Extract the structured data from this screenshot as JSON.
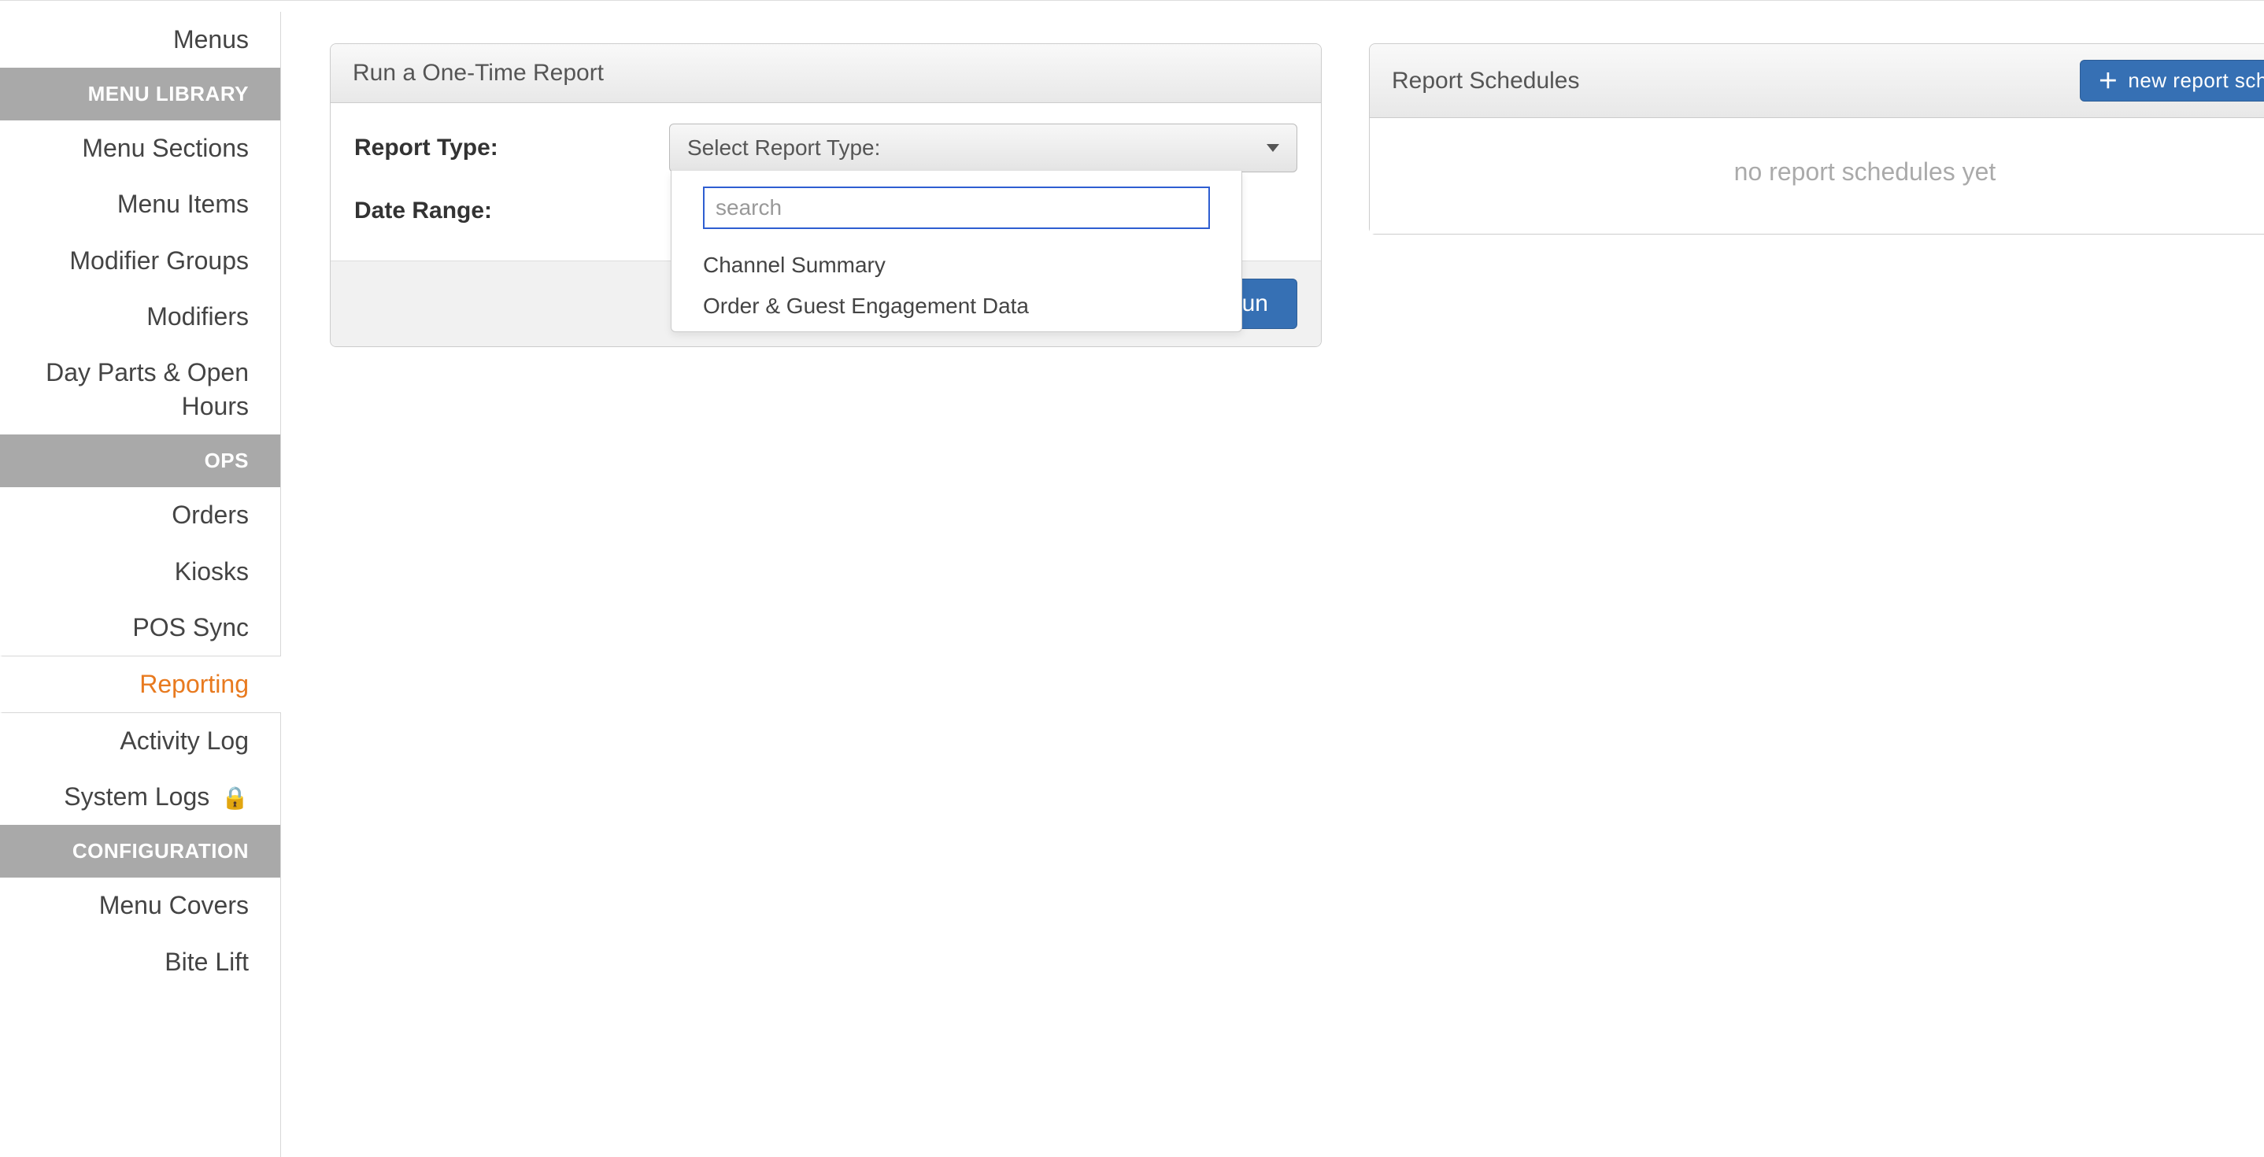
{
  "sidebar": {
    "top_items": [
      {
        "label": "Menus"
      }
    ],
    "sections": [
      {
        "header": "MENU LIBRARY",
        "items": [
          {
            "label": "Menu Sections"
          },
          {
            "label": "Menu Items"
          },
          {
            "label": "Modifier Groups"
          },
          {
            "label": "Modifiers"
          },
          {
            "label": "Day Parts & Open Hours"
          }
        ]
      },
      {
        "header": "OPS",
        "items": [
          {
            "label": "Orders"
          },
          {
            "label": "Kiosks"
          },
          {
            "label": "POS Sync"
          },
          {
            "label": "Reporting",
            "active": true
          },
          {
            "label": "Activity Log"
          },
          {
            "label": "System Logs",
            "locked": true
          }
        ]
      },
      {
        "header": "CONFIGURATION",
        "items": [
          {
            "label": "Menu Covers"
          },
          {
            "label": "Bite Lift"
          }
        ]
      }
    ]
  },
  "run_panel": {
    "title": "Run a One-Time Report",
    "report_type_label": "Report Type:",
    "report_type_placeholder": "Select Report Type:",
    "date_range_label": "Date Range:",
    "run_button": "Run",
    "dropdown": {
      "search_placeholder": "search",
      "options": [
        "Channel Summary",
        "Order & Guest Engagement Data"
      ]
    }
  },
  "schedules_panel": {
    "title": "Report Schedules",
    "new_button": "new report schedule",
    "empty": "no report schedules yet"
  }
}
